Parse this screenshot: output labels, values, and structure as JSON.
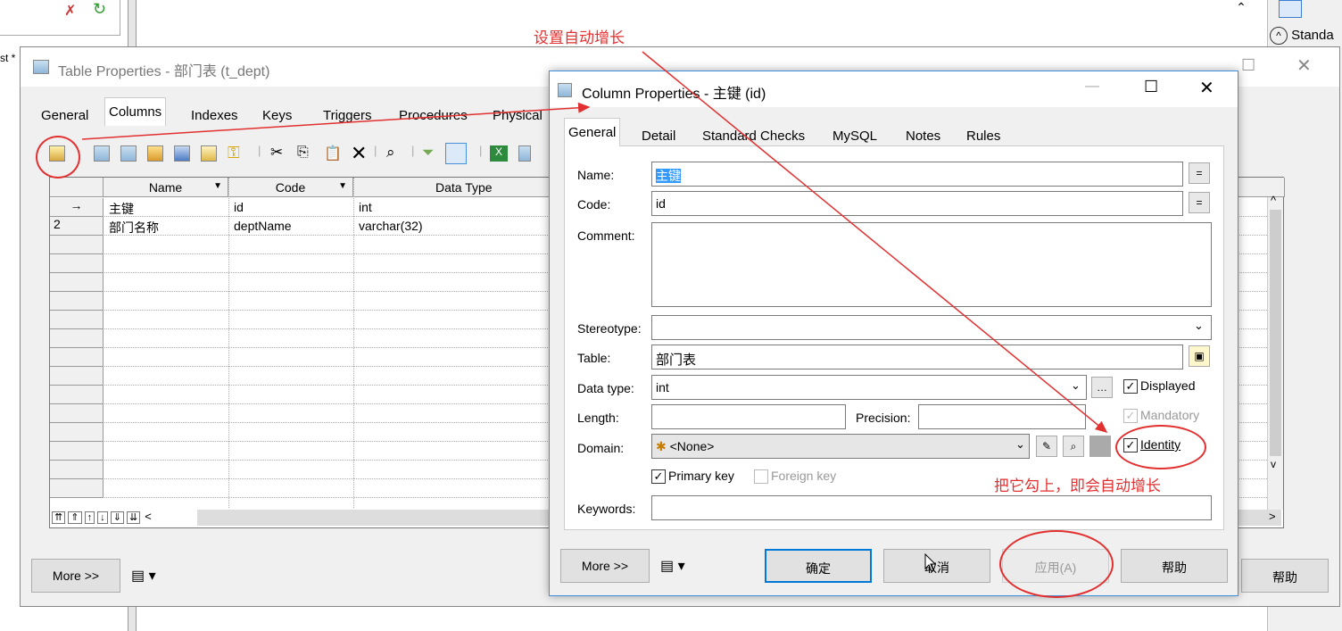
{
  "annotations": {
    "top_note": "设置自动增长",
    "side_note": "把它勾上，即会自动增长"
  },
  "background": {
    "left_cut_text": "st *",
    "right_cut_text": "Standa"
  },
  "table_props": {
    "title": "Table Properties - 部门表 (t_dept)",
    "tabs": [
      "General",
      "Columns",
      "Indexes",
      "Keys",
      "Triggers",
      "Procedures",
      "Physical"
    ],
    "selected_tab": "Columns",
    "columns": [
      "Name",
      "Code",
      "Data Type"
    ],
    "rows": [
      {
        "marker": "→",
        "name": "主键",
        "code": "id",
        "type": "int"
      },
      {
        "marker": "2",
        "name": "部门名称",
        "code": "deptName",
        "type": "varchar(32)"
      }
    ],
    "more_label": "More >>",
    "help_label": "帮助"
  },
  "col_props": {
    "title": "Column Properties - 主键 (id)",
    "tabs": [
      "General",
      "Detail",
      "Standard Checks",
      "MySQL",
      "Notes",
      "Rules"
    ],
    "selected_tab": "General",
    "labels": {
      "name": "Name:",
      "code": "Code:",
      "comment": "Comment:",
      "stereotype": "Stereotype:",
      "table": "Table:",
      "data_type": "Data type:",
      "length": "Length:",
      "precision": "Precision:",
      "domain": "Domain:",
      "keywords": "Keywords:"
    },
    "values": {
      "name": "主键",
      "code": "id",
      "comment": "",
      "stereotype": "",
      "table": "部门表",
      "data_type": "int",
      "length": "",
      "precision": "",
      "domain": "<None>",
      "keywords": ""
    },
    "checks": {
      "displayed": "Displayed",
      "mandatory": "Mandatory",
      "identity": "Identity",
      "primary_key": "Primary key",
      "foreign_key": "Foreign key"
    },
    "buttons": {
      "more": "More >>",
      "ok": "确定",
      "cancel": "取消",
      "apply": "应用(A)",
      "help": "帮助"
    }
  }
}
